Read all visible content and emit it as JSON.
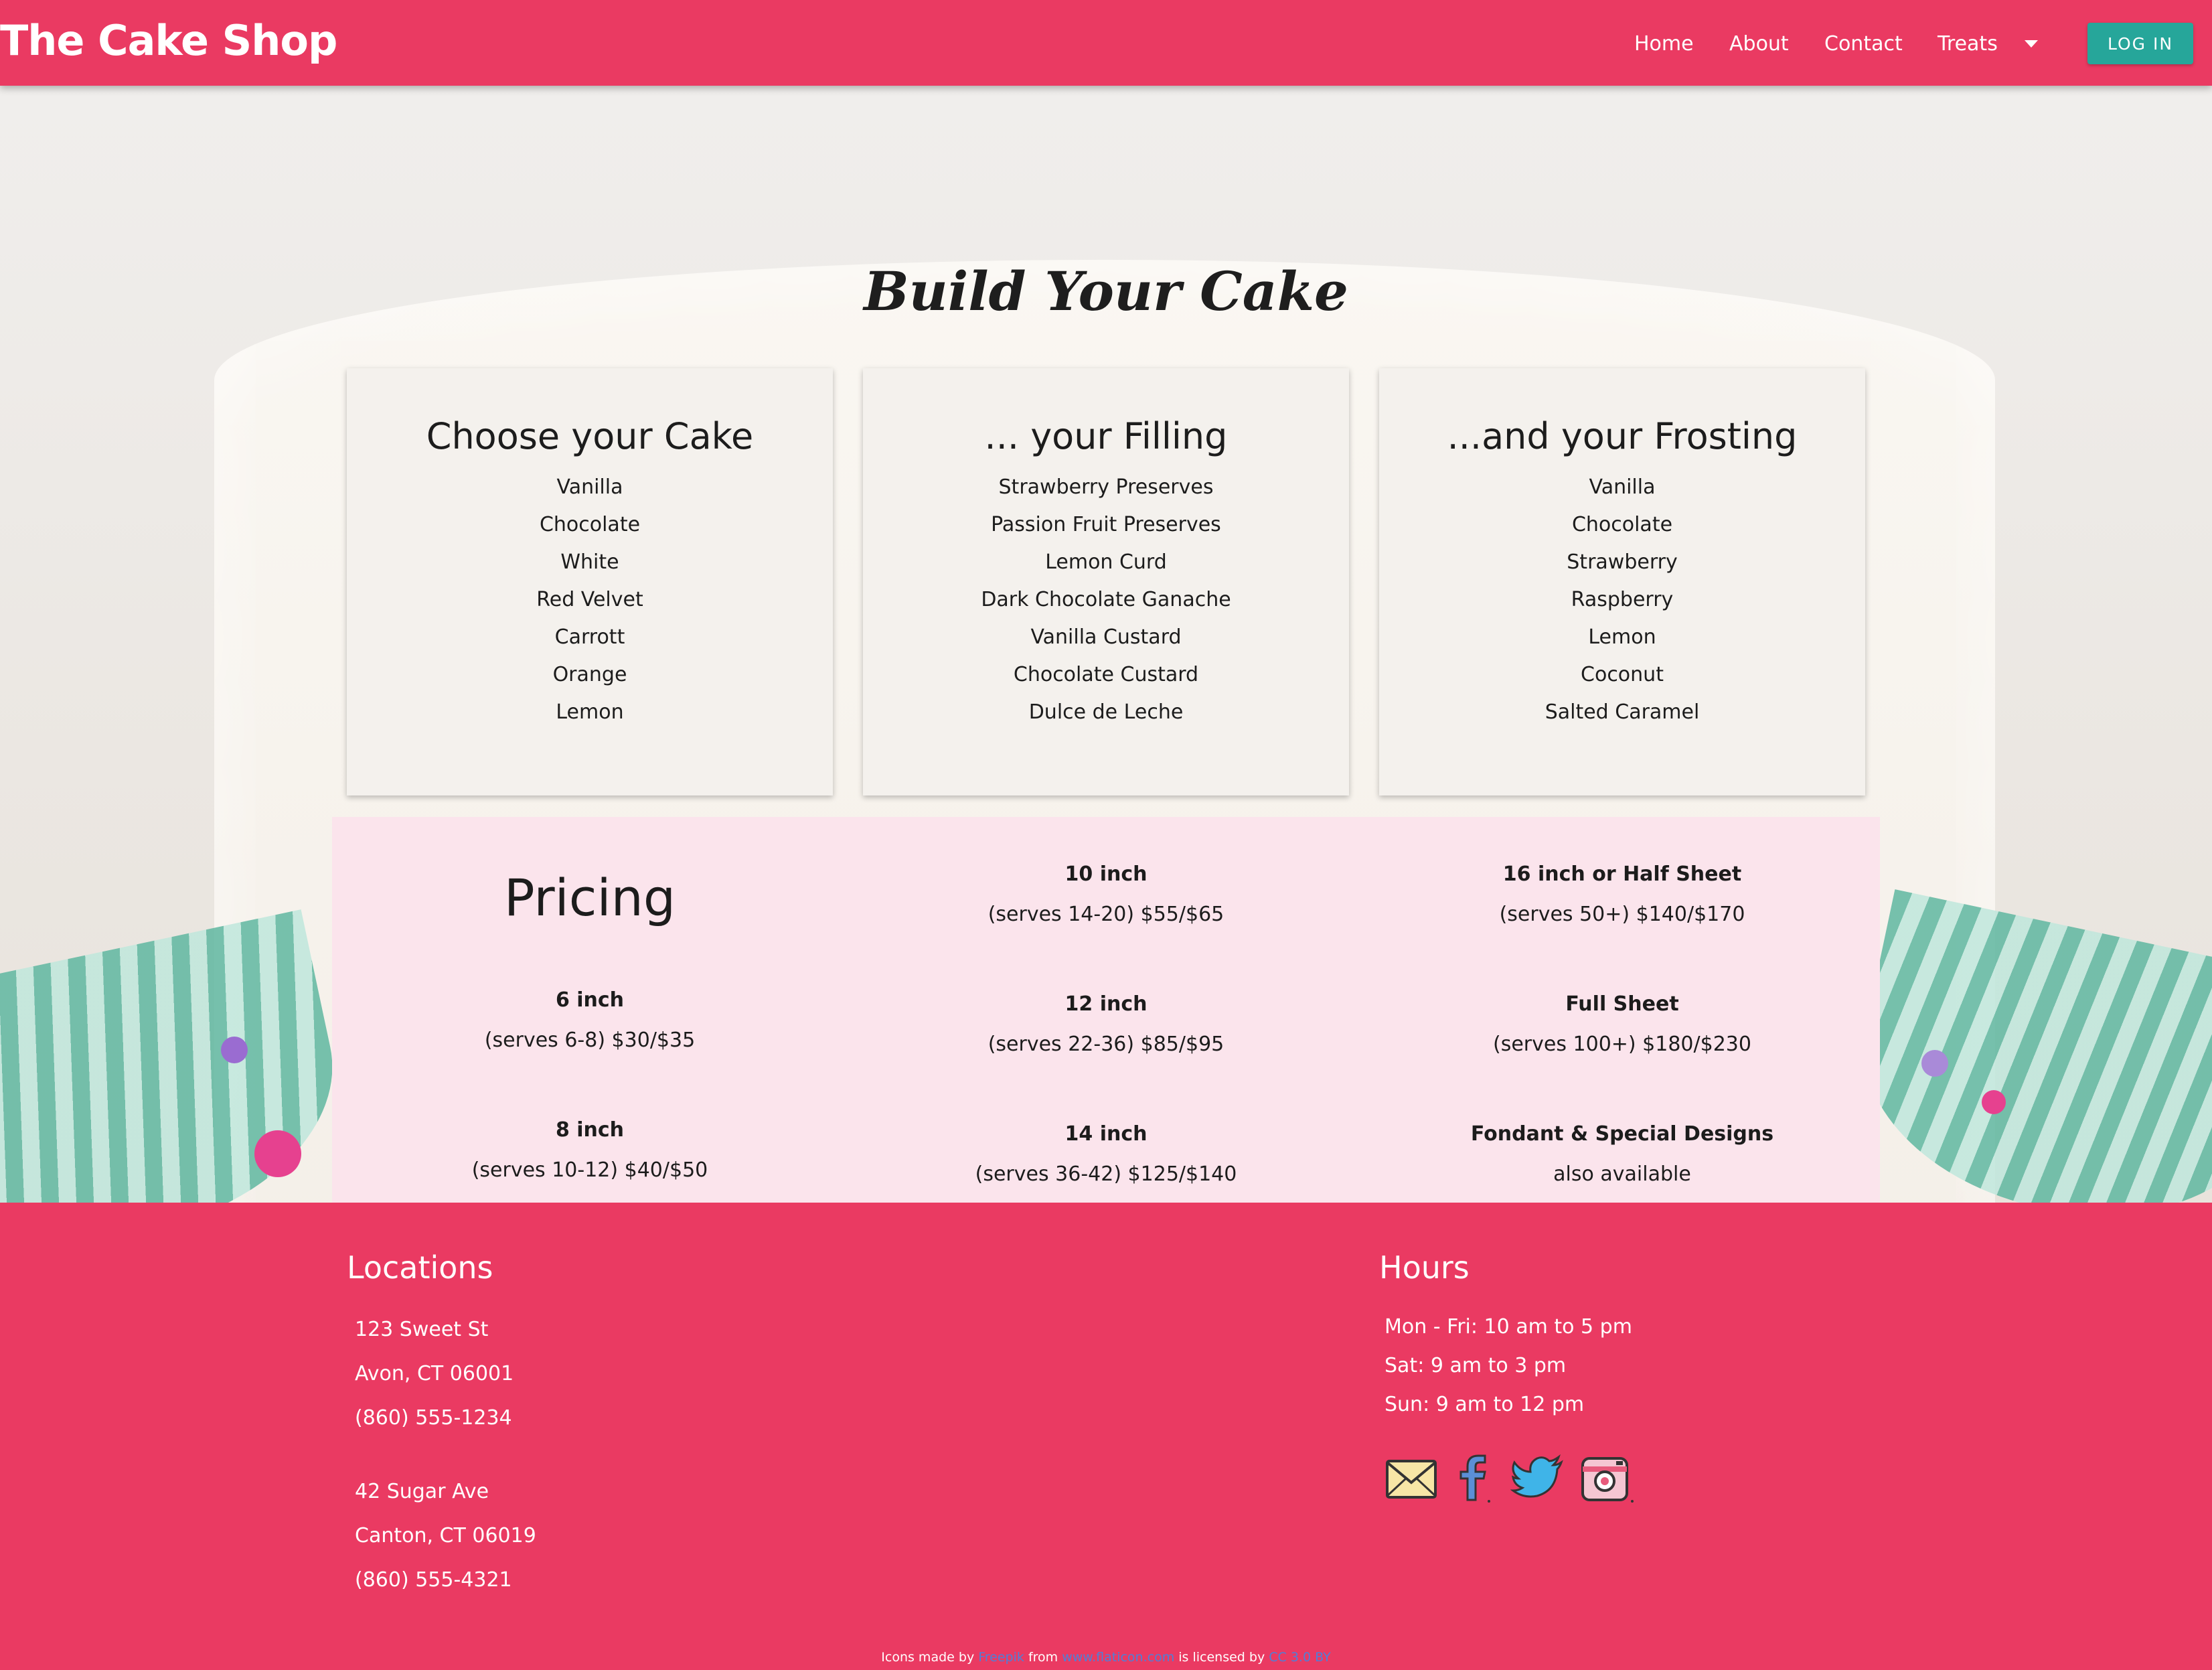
{
  "navbar": {
    "brand": "The Cake Shop",
    "links": [
      {
        "label": "Home"
      },
      {
        "label": "About"
      },
      {
        "label": "Contact"
      },
      {
        "label": "Treats"
      }
    ],
    "login_label": "LOG IN"
  },
  "page_title": "Build Your Cake",
  "cards": [
    {
      "title": "Choose your Cake",
      "items": [
        "Vanilla",
        "Chocolate",
        "White",
        "Red Velvet",
        "Carrott",
        "Orange",
        "Lemon"
      ]
    },
    {
      "title": "... your Filling",
      "items": [
        "Strawberry Preserves",
        "Passion Fruit Preserves",
        "Lemon Curd",
        "Dark Chocolate Ganache",
        "Vanilla Custard",
        "Chocolate Custard",
        "Dulce de Leche"
      ]
    },
    {
      "title": "...and your Frosting",
      "items": [
        "Vanilla",
        "Chocolate",
        "Strawberry",
        "Raspberry",
        "Lemon",
        "Coconut",
        "Salted Caramel"
      ]
    }
  ],
  "pricing": {
    "title": "Pricing",
    "col1": [
      {
        "size": "6 inch",
        "detail": "(serves 6-8) $30/$35"
      },
      {
        "size": "8 inch",
        "detail": "(serves 10-12) $40/$50"
      }
    ],
    "col2": [
      {
        "size": "10 inch",
        "detail": "(serves 14-20) $55/$65"
      },
      {
        "size": "12 inch",
        "detail": "(serves 22-36) $85/$95"
      },
      {
        "size": "14 inch",
        "detail": "(serves 36-42) $125/$140"
      }
    ],
    "col3": [
      {
        "size": "16 inch or Half Sheet",
        "detail": "(serves 50+) $140/$170"
      },
      {
        "size": "Full Sheet",
        "detail": "(serves 100+) $180/$230"
      },
      {
        "size": "Fondant & Special Designs",
        "detail": "also available"
      }
    ]
  },
  "footer": {
    "locations_heading": "Locations",
    "locations": [
      {
        "street": "123 Sweet St",
        "city": "Avon, CT 06001",
        "phone": "(860) 555-1234"
      },
      {
        "street": "42 Sugar Ave",
        "city": "Canton, CT 06019",
        "phone": "(860) 555-4321"
      }
    ],
    "hours_heading": "Hours",
    "hours": [
      "Mon - Fri: 10 am to 5 pm",
      "Sat: 9 am to 3 pm",
      "Sun: 9 am to 12 pm"
    ],
    "social_icons": [
      "mail-icon",
      "facebook-icon",
      "twitter-icon",
      "instagram-icon"
    ],
    "credits": {
      "prefix": "Icons made by",
      "author": "Freepik",
      "from": "from",
      "site": "www.flaticon.com",
      "licensed": "is licensed by",
      "license": "CC 3.0 BY"
    }
  },
  "colors": {
    "brand": "#ea3a62",
    "login_button": "#26a69a",
    "pricing_bg": "#fbe4ec",
    "credit_link": "#4f7fd8"
  }
}
